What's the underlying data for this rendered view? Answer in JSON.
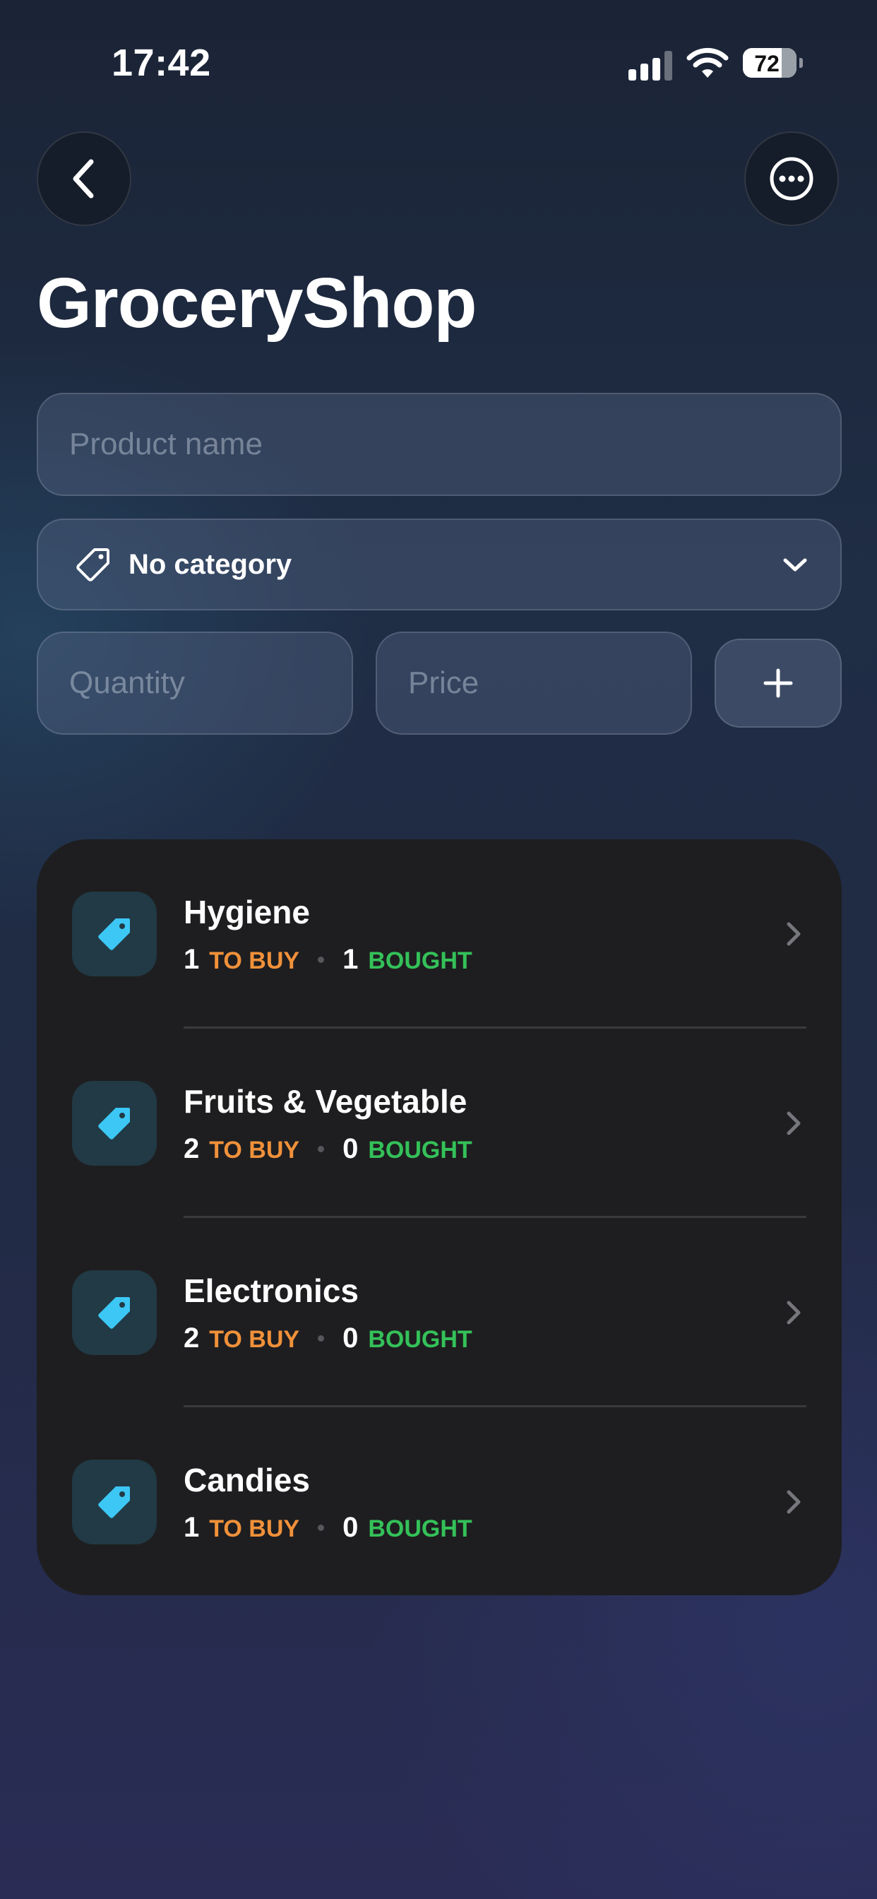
{
  "status_bar": {
    "time": "17:42",
    "battery": "72"
  },
  "header": {
    "title": "GroceryShop"
  },
  "form": {
    "product_placeholder": "Product name",
    "category_label": "No category",
    "quantity_placeholder": "Quantity",
    "price_placeholder": "Price"
  },
  "categories": [
    {
      "name": "Hygiene",
      "to_buy": "1",
      "to_buy_label": "TO BUY",
      "bought": "1",
      "bought_label": "BOUGHT"
    },
    {
      "name": "Fruits & Vegetable",
      "to_buy": "2",
      "to_buy_label": "TO BUY",
      "bought": "0",
      "bought_label": "BOUGHT"
    },
    {
      "name": "Electronics",
      "to_buy": "2",
      "to_buy_label": "TO BUY",
      "bought": "0",
      "bought_label": "BOUGHT"
    },
    {
      "name": "Candies",
      "to_buy": "1",
      "to_buy_label": "TO BUY",
      "bought": "0",
      "bought_label": "BOUGHT"
    }
  ],
  "colors": {
    "to_buy": "#f0913a",
    "bought": "#34c159",
    "tag_icon": "#3cc7f5"
  },
  "icons": [
    "signal-icon",
    "wifi-icon",
    "battery-icon",
    "back-chevron-icon",
    "more-icon",
    "tag-icon",
    "chevron-down-icon",
    "plus-icon",
    "chevron-right-icon"
  ]
}
